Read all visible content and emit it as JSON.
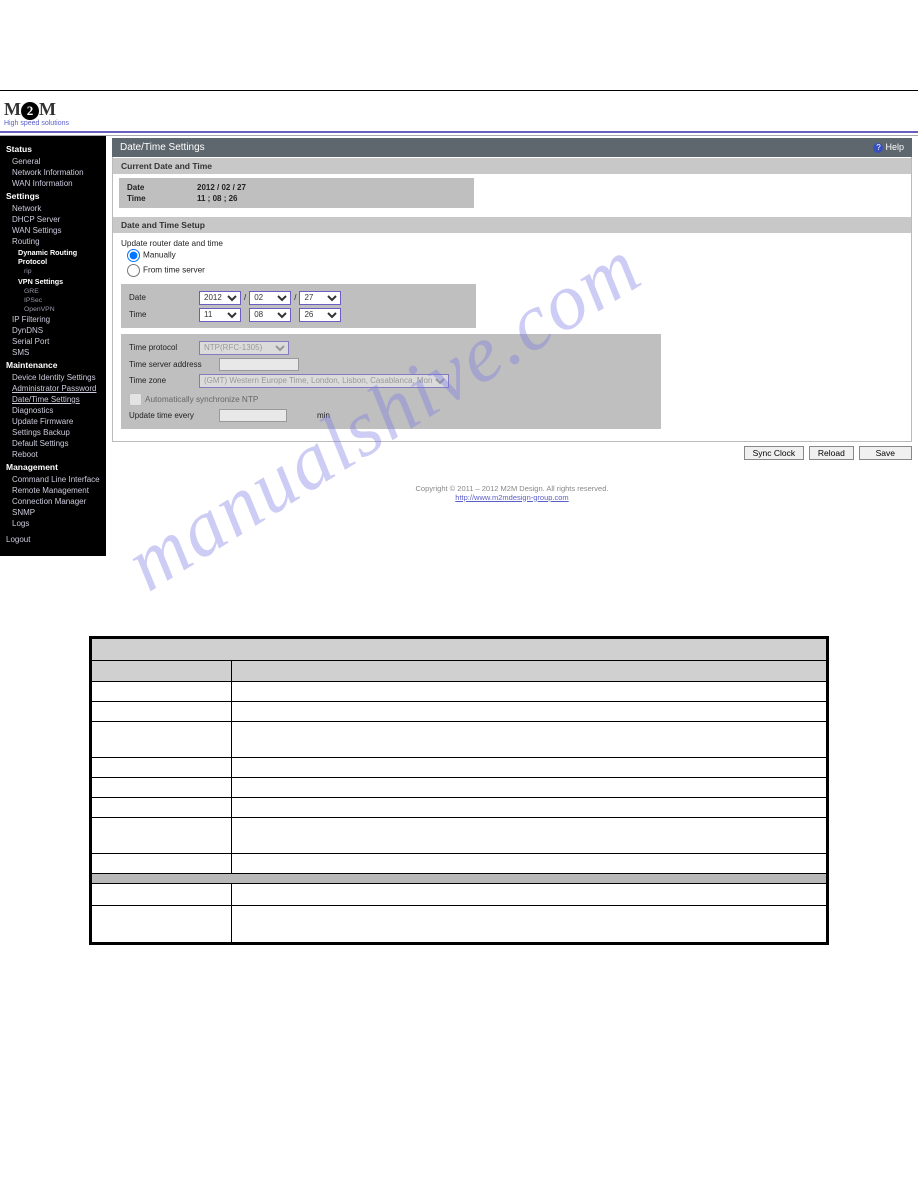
{
  "logo": {
    "text_left": "M",
    "text_mid": "2",
    "text_right": "M",
    "subtitle": "High speed solutions"
  },
  "panel": {
    "title": "Date/Time Settings",
    "help_label": "Help",
    "section_current": "Current Date and Time",
    "current": {
      "date_label": "Date",
      "date_value": "2012 / 02 / 27",
      "time_label": "Time",
      "time_value": "11 ; 08 ; 26"
    },
    "section_setup": "Date and Time Setup",
    "update_label": "Update router date and time",
    "radio_manual": "Manually",
    "radio_server": "From time server",
    "form_date": {
      "label": "Date",
      "year": "2012",
      "month": "02",
      "day": "27"
    },
    "form_time": {
      "label": "Time",
      "hour": "11",
      "min": "08",
      "sec": "26"
    },
    "protocol_label": "Time protocol",
    "protocol_value": "NTP(RFC-1305)",
    "server_label": "Time server address",
    "zone_label": "Time zone",
    "zone_value": "(GMT) Western Europe Time, London, Lisbon, Casablanca, Monrovia",
    "auto_sync": "Automatically synchronize NTP",
    "update_every": "Update time every",
    "min_unit": "min"
  },
  "buttons": {
    "sync": "Sync Clock",
    "reload": "Reload",
    "save": "Save"
  },
  "footer": {
    "copyright": "Copyright © 2011 – 2012 M2M Design. All rights reserved.",
    "link": "http://www.m2mdesign-group.com"
  },
  "sidebar": {
    "status": "Status",
    "status_items": [
      "General",
      "Network Information",
      "WAN Information"
    ],
    "settings": "Settings",
    "settings_items": [
      "Network",
      "DHCP Server",
      "WAN Settings",
      "Routing"
    ],
    "routing_proto": "Dynamic Routing Protocol",
    "routing_proto_items": [
      "rip"
    ],
    "vpn": "VPN Settings",
    "vpn_items": [
      "GRE",
      "IPSec",
      "OpenVPN"
    ],
    "settings_more": [
      "IP Filtering",
      "DynDNS",
      "Serial Port",
      "SMS"
    ],
    "maintenance": "Maintenance",
    "maintenance_items": [
      "Device Identity Settings",
      "Administrator Password",
      "Date/Time Settings",
      "Diagnostics",
      "Update Firmware",
      "Settings Backup",
      "Default Settings",
      "Reboot"
    ],
    "management": "Management",
    "management_items": [
      "Command Line Interface",
      "Remote Management",
      "Connection Manager",
      "SNMP",
      "Logs"
    ],
    "logout": "Logout"
  },
  "watermark": "manualshive.com"
}
